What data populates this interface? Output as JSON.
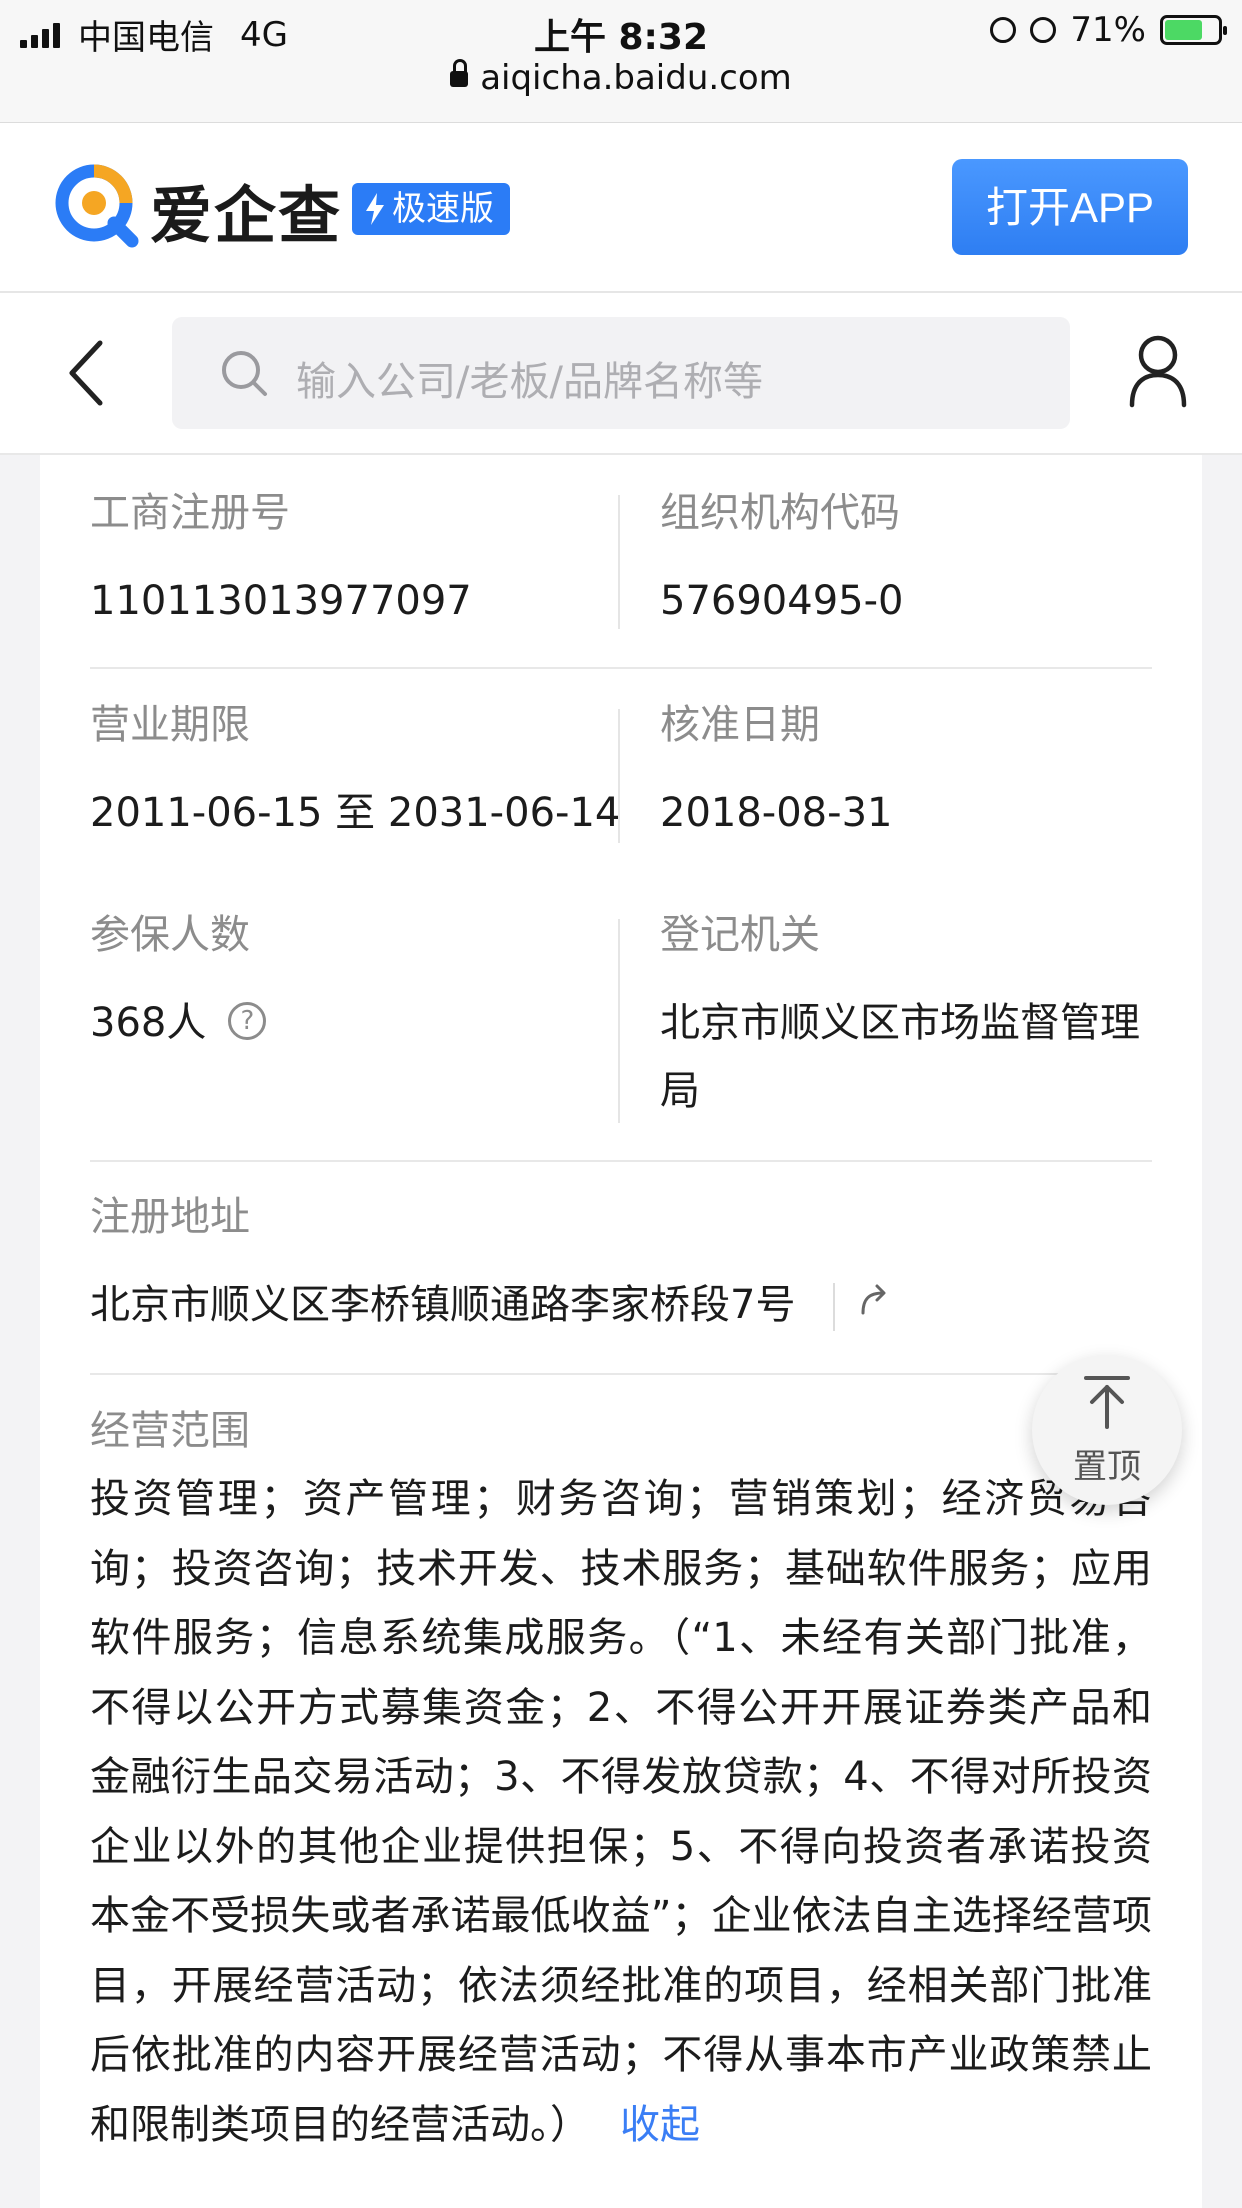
{
  "status_bar": {
    "carrier": "中国电信",
    "network": "4G",
    "time": "上午 8:32",
    "url": "aiqicha.baidu.com",
    "battery": "71%",
    "battery_level": 0.71
  },
  "header": {
    "logo_text": "爱企查",
    "badge": "极速版",
    "open_app": "打开APP"
  },
  "search": {
    "placeholder": "输入公司/老板/品牌名称等"
  },
  "fields": {
    "reg_no_label": "工商注册号",
    "reg_no_value": "110113013977097",
    "org_code_label": "组织机构代码",
    "org_code_value": "57690495-0",
    "term_label": "营业期限",
    "term_value": "2011-06-15 至 2031-06-14",
    "approve_label": "核准日期",
    "approve_value": "2018-08-31",
    "insured_label": "参保人数",
    "insured_value": "368人",
    "authority_label": "登记机关",
    "authority_value": "北京市顺义区市场监督管理局",
    "address_label": "注册地址",
    "address_value": "北京市顺义区李桥镇顺通路李家桥段7号",
    "scope_label": "经营范围",
    "scope_value": "投资管理；资产管理；财务咨询；营销策划；经济贸易咨询；投资咨询；技术开发、技术服务；基础软件服务；应用软件服务；信息系统集成服务。（“1、未经有关部门批准，不得以公开方式募集资金；2、不得公开开展证券类产品和金融衍生品交易活动；3、不得发放贷款；4、不得对所投资企业以外的其他企业提供担保；5、不得向投资者承诺投资本金不受损失或者承诺最低收益”；企业依法自主选择经营项目，开展经营活动；依法须经批准的项目，经相关部门批准后依批准的内容开展经营活动；不得从事本市产业政策禁止和限制类项目的经营活动。）",
    "collapse": "收起"
  },
  "back_to_top": "置顶"
}
